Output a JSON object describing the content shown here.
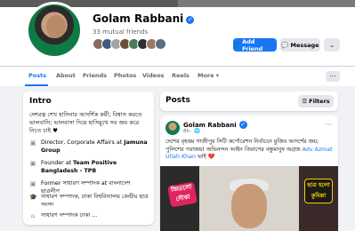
{
  "profile": {
    "name": "Golam Rabbani",
    "verified_mark": "✓",
    "mutual_friends": "33 mutual friends",
    "add_friend_label": "Add Friend",
    "message_label": "Message",
    "more_label": "⌄",
    "friend_avatar_colors": [
      "#8b6b5a",
      "#3d5a80",
      "#a3a3a3",
      "#6b4f3b",
      "#4a7c59",
      "#2f2f2f",
      "#9c7a62",
      "#5d6d7e"
    ]
  },
  "tabs": {
    "items": [
      "Posts",
      "About",
      "Friends",
      "Photos",
      "Videos",
      "Reels",
      "More ▾"
    ],
    "active": "Posts",
    "overflow_label": "···"
  },
  "intro": {
    "title": "Intro",
    "bio": "দেশরত্ন শেখ হাসিনার আদর্শিক কর্মী; বিশ্বাস করতে ভালবাসি; ভালবাসা দিয়ে হাসিমুখে সব জয় করে নিতে চাই ♥",
    "items": [
      {
        "icon": "briefcase-icon",
        "prefix": "Director, Corporate Affairs at ",
        "bold": "Jamuna Group"
      },
      {
        "icon": "briefcase-icon",
        "prefix": "Founder at ",
        "bold": "Team Positive Bangladesh - TPB"
      },
      {
        "icon": "briefcase-icon",
        "prefix": "Former সাধারণ সম্পাদক at বাংলাদেশ ছাত্রলীগ",
        "bold": ""
      },
      {
        "icon": "graduation-cap-icon",
        "prefix": "সাধারণ সম্পাদক, ঢাকা বিশ্ববিদ্যালয় কেন্দ্রীয় ছাত্র সংসদ",
        "bold": ""
      },
      {
        "icon": "home-icon",
        "prefix": "সাধারণ সম্পাদক ঢাকা ...",
        "bold": ""
      }
    ]
  },
  "posts_header": {
    "title": "Posts",
    "filters_label": "Filters"
  },
  "post": {
    "author": "Golam Rabbani",
    "time": "8h · 🌐",
    "menu": "···",
    "text_before": "দেশের বৃহত্তম গাজীপুর সিটি কর্পোরেশন নির্বাচনে মুজিব আদর্শের জয়; পুলিশের পরাজয়! অভিনন্দন আইন বিভাগের বন্ধুমানুষ অগ্রজ ",
    "mention": "Adv Azmat Ullah Khan",
    "text_after": " ভাই ❤️",
    "image_badge_left": "জিতলো নৌকা",
    "image_badge_right": "ছাত্র হলো কুমিল্লা"
  },
  "colors": {
    "accent": "#1877f2",
    "page_bg": "#f0f2f5",
    "secondary_button": "#e4e6eb"
  }
}
